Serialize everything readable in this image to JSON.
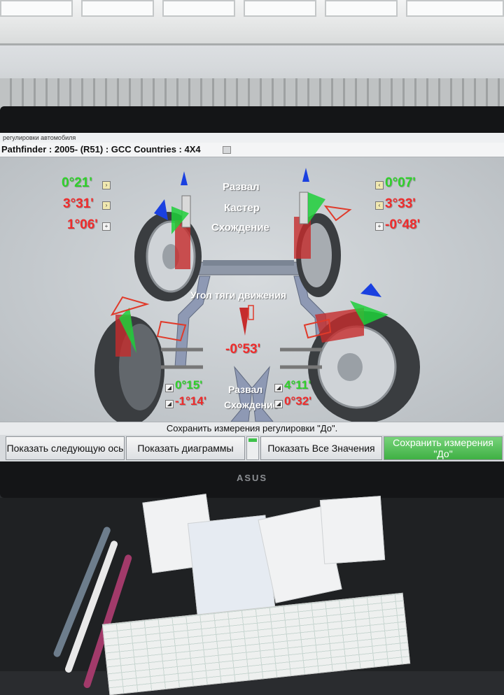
{
  "window_title": "регулировки автомобиля",
  "vehicle": "Pathfinder : 2005-  (R51) : GCC Countries : 4X4",
  "front": {
    "camber_label": "Развал",
    "caster_label": "Кастер",
    "toe_label": "Схождение",
    "left": {
      "camber": "0°21'",
      "caster": "3°31'",
      "toe": "1°06'"
    },
    "right": {
      "camber": "0°07'",
      "caster": "3°33'",
      "toe": "-0°48'"
    }
  },
  "thrust": {
    "label": "Угол тяги движения",
    "value": "-0°53'"
  },
  "rear": {
    "camber_label": "Развал",
    "toe_label": "Схождение",
    "left": {
      "camber": "0°15'",
      "toe": "-1°14'"
    },
    "right": {
      "camber": "4°11'",
      "toe": "0°32'"
    }
  },
  "status_text": "Сохранить измерения регулировки \"До\".",
  "buttons": {
    "next_axle": "Показать следующую ось",
    "diagrams": "Показать диаграммы",
    "all_values": "Показать Все Значения",
    "save_before": "Сохранить измерения \"До\""
  },
  "monitor_brand": "ASUS",
  "colors": {
    "in_spec": "#2fd12a",
    "out_of_spec": "#ef2c2c",
    "save_button": "#3fb044"
  }
}
